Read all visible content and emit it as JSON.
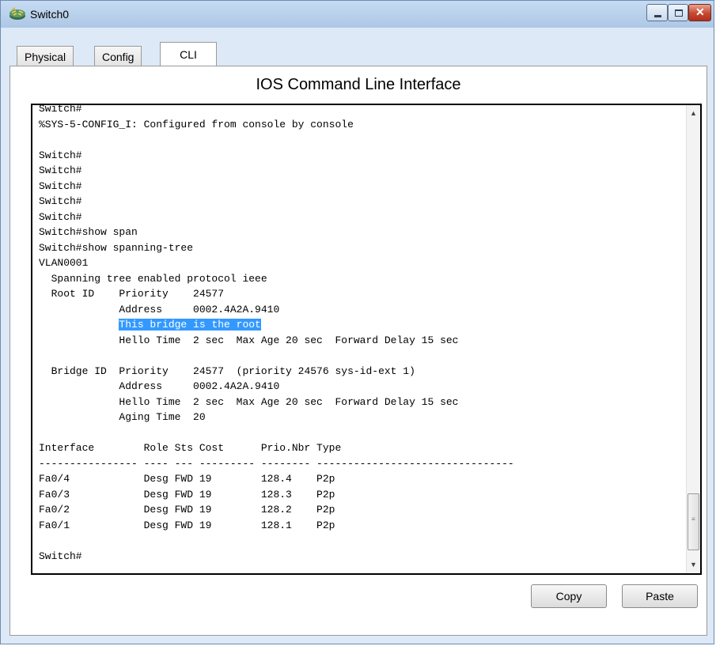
{
  "window": {
    "title": "Switch0"
  },
  "tabs": [
    {
      "label": "Physical",
      "active": false
    },
    {
      "label": "Config",
      "active": false
    },
    {
      "label": "CLI",
      "active": true
    }
  ],
  "panel": {
    "heading": "IOS Command Line Interface"
  },
  "terminal": {
    "lines": [
      "Switch#",
      "%SYS-5-CONFIG_I: Configured from console by console",
      "",
      "Switch#",
      "Switch#",
      "Switch#",
      "Switch#",
      "Switch#",
      "Switch#show span",
      "Switch#show spanning-tree",
      "VLAN0001",
      "  Spanning tree enabled protocol ieee",
      "  Root ID    Priority    24577",
      "             Address     0002.4A2A.9410",
      "             This bridge is the root",
      "             Hello Time  2 sec  Max Age 20 sec  Forward Delay 15 sec",
      "",
      "  Bridge ID  Priority    24577  (priority 24576 sys-id-ext 1)",
      "             Address     0002.4A2A.9410",
      "             Hello Time  2 sec  Max Age 20 sec  Forward Delay 15 sec",
      "             Aging Time  20",
      "",
      "Interface        Role Sts Cost      Prio.Nbr Type",
      "---------------- ---- --- --------- -------- --------------------------------",
      "Fa0/4            Desg FWD 19        128.4    P2p",
      "Fa0/3            Desg FWD 19        128.3    P2p",
      "Fa0/2            Desg FWD 19        128.2    P2p",
      "Fa0/1            Desg FWD 19        128.1    P2p",
      "",
      "Switch#"
    ],
    "selection": {
      "line_index": 14,
      "prefix": "             ",
      "text": "This bridge is the root"
    }
  },
  "buttons": {
    "copy": "Copy",
    "paste": "Paste"
  },
  "icons": {
    "app": "switch-device-icon",
    "minimize": "minimize-icon",
    "maximize": "maximize-icon",
    "close": "close-icon"
  },
  "colors": {
    "selection": "#3399ff",
    "close_button": "#c7472e"
  }
}
